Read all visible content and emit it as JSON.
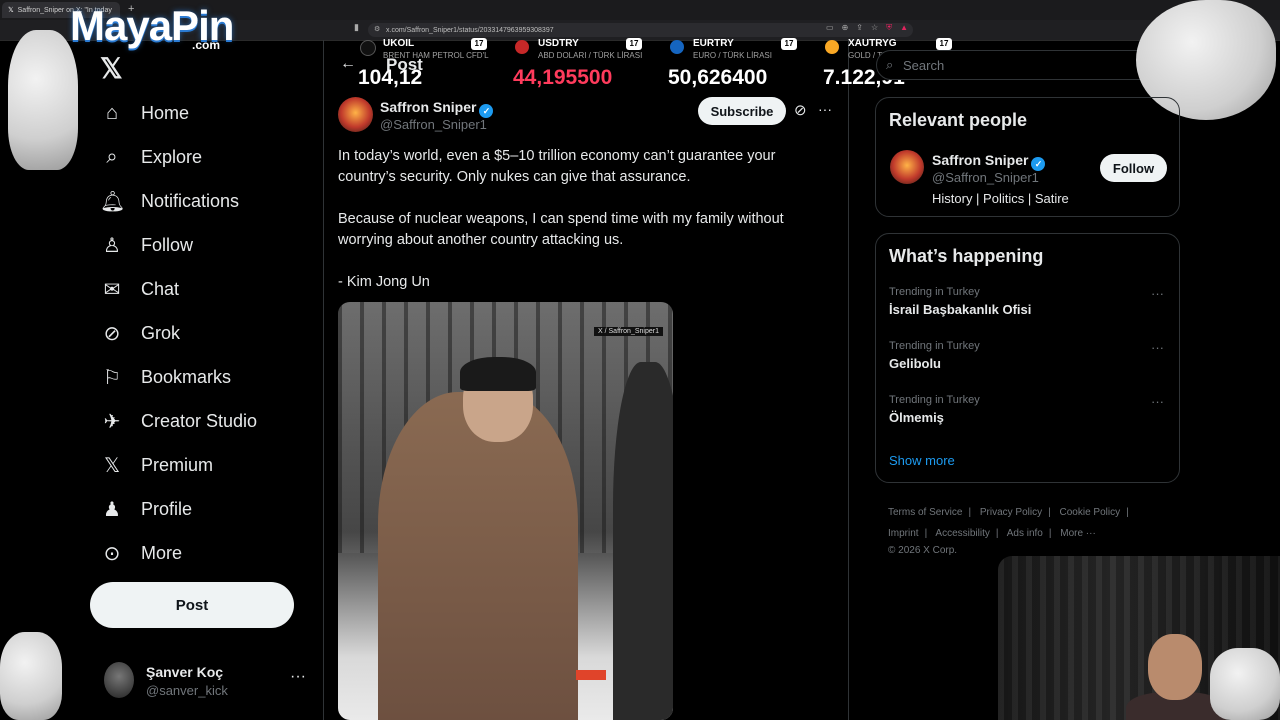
{
  "browser": {
    "tab_title": "Saffron_Sniper on X: \"In today",
    "new_tab": "+",
    "url": "x.com/Saffron_Sniper1/status/2033147963959308397"
  },
  "overlay": {
    "logo_text": "MayaPin",
    "logo_sub": ".com"
  },
  "ticker": [
    {
      "symbol": "UKOIL",
      "desc": "BRENT HAM PETROL CFD'L",
      "value": "104,12",
      "color": "#111111",
      "trend": "up"
    },
    {
      "symbol": "USDTRY",
      "desc": "ABD DOLARI / TÜRK LİRASI",
      "value": "44,195500",
      "color": "#c62828",
      "trend": "down"
    },
    {
      "symbol": "EURTRY",
      "desc": "EURO / TÜRK LİRASI",
      "value": "50,626400",
      "color": "#1565c0",
      "trend": "up"
    },
    {
      "symbol": "XAUTRYG",
      "desc": "GOLD / TURKISH LIRA GRA",
      "value": "7.122,91",
      "color": "#f9a825",
      "trend": "up"
    }
  ],
  "ticker_badge": "17",
  "nav": {
    "x_logo": "𝕏",
    "items": [
      {
        "label": "Home",
        "icon": "⌂"
      },
      {
        "label": "Explore",
        "icon": "⌕"
      },
      {
        "label": "Notifications",
        "icon": "🔔︎"
      },
      {
        "label": "Follow",
        "icon": "♙"
      },
      {
        "label": "Chat",
        "icon": "✉"
      },
      {
        "label": "Grok",
        "icon": "⊘"
      },
      {
        "label": "Bookmarks",
        "icon": "⚐"
      },
      {
        "label": "Creator Studio",
        "icon": "✈"
      },
      {
        "label": "Premium",
        "icon": "𝕏"
      },
      {
        "label": "Profile",
        "icon": "♟"
      },
      {
        "label": "More",
        "icon": "⊙"
      }
    ],
    "post_button": "Post"
  },
  "account": {
    "name": "Şanver Koç",
    "handle": "@sanver_kick",
    "more": "···"
  },
  "main": {
    "header_title": "Post",
    "back": "←",
    "author": {
      "name": "Saffron Sniper",
      "handle": "@Saffron_Sniper1",
      "verified": "✓"
    },
    "subscribe": "Subscribe",
    "more": "···",
    "paragraphs": [
      "In today’s world, even a $5–10 trillion economy can’t guarantee your country’s security. Only nukes can give that assurance.",
      "Because of nuclear weapons, I can spend time with my family without worrying about another country attacking us.",
      "- Kim Jong Un"
    ],
    "media_watermark": "X / Saffron_Sniper1"
  },
  "right": {
    "search_placeholder": "Search",
    "relevant_title": "Relevant people",
    "relevant": {
      "name": "Saffron Sniper",
      "handle": "@Saffron_Sniper1",
      "bio": "History | Politics | Satire",
      "follow": "Follow"
    },
    "happening_title": "What’s happening",
    "trends": [
      {
        "context": "Trending in Turkey",
        "name": "İsrail Başbakanlık Ofisi"
      },
      {
        "context": "Trending in Turkey",
        "name": "Gelibolu"
      },
      {
        "context": "Trending in Turkey",
        "name": "Ölmemiş"
      }
    ],
    "trend_more": "···",
    "show_more": "Show more",
    "footer": {
      "links_row1": [
        "Terms of Service",
        "Privacy Policy",
        "Cookie Policy"
      ],
      "links_row2": [
        "Imprint",
        "Accessibility",
        "Ads info",
        "More ···"
      ],
      "copyright": "© 2026 X Corp."
    }
  }
}
